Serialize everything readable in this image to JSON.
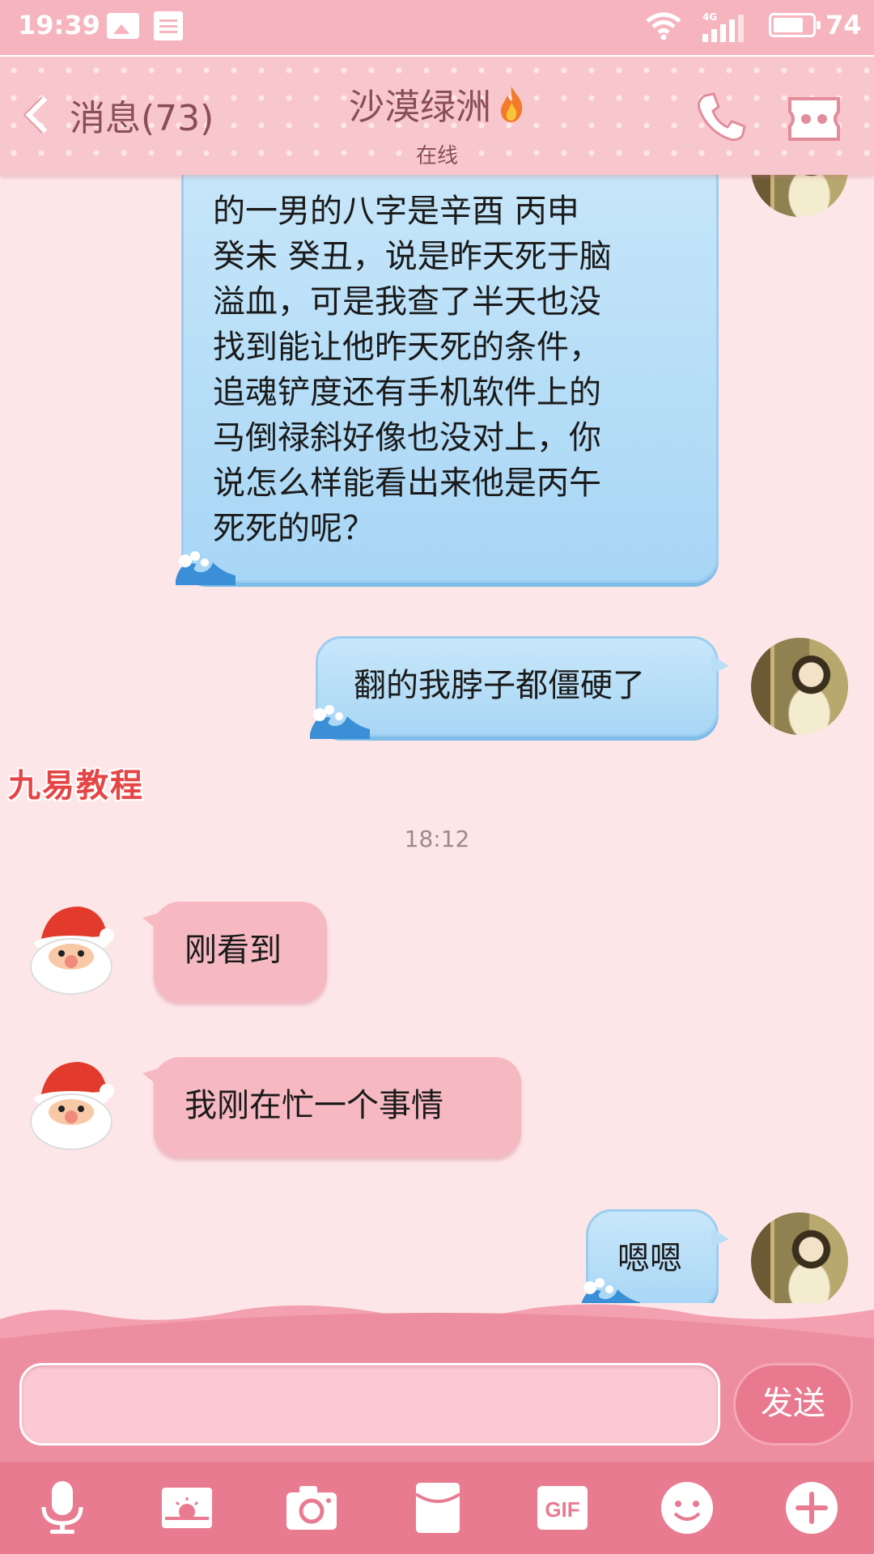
{
  "status_bar": {
    "time": "19:39",
    "network": "4G",
    "battery": "74"
  },
  "header": {
    "back_label": "消息(73)",
    "contact_name": "沙漠绿洲",
    "status": "在线",
    "icons": [
      "phone-icon",
      "profile-card-icon",
      "flame-icon"
    ]
  },
  "messages": [
    {
      "side": "outgoing",
      "lines": [
        "的一男的八字是辛酉 丙申",
        "癸未 癸丑，说是昨天死于脑",
        "溢血，可是我查了半天也没",
        "找到能让他昨天死的条件，",
        "追魂铲度还有手机软件上的",
        "马倒禄斜好像也没对上，你",
        "说怎么样能看出来他是丙午",
        "死死的呢？"
      ]
    },
    {
      "side": "outgoing",
      "text": "翻的我脖子都僵硬了"
    },
    {
      "side": "incoming",
      "text": "刚看到"
    },
    {
      "side": "incoming",
      "text": "我刚在忙一个事情"
    },
    {
      "side": "outgoing",
      "text": "嗯嗯"
    }
  ],
  "timestamp": "18:12",
  "watermark": "九易教程",
  "composer": {
    "input_value": "",
    "send_label": "发送",
    "toolbar": [
      "microphone-icon",
      "picture-icon",
      "camera-icon",
      "red-envelope-icon",
      "gif-icon",
      "emoji-icon",
      "plus-icon"
    ]
  },
  "colors": {
    "header": "#f8c7cd",
    "outgoing_bubble": "#b9def7",
    "incoming_bubble": "#f6b9c2",
    "background": "#fde6e8",
    "send_button": "#e9798f"
  }
}
